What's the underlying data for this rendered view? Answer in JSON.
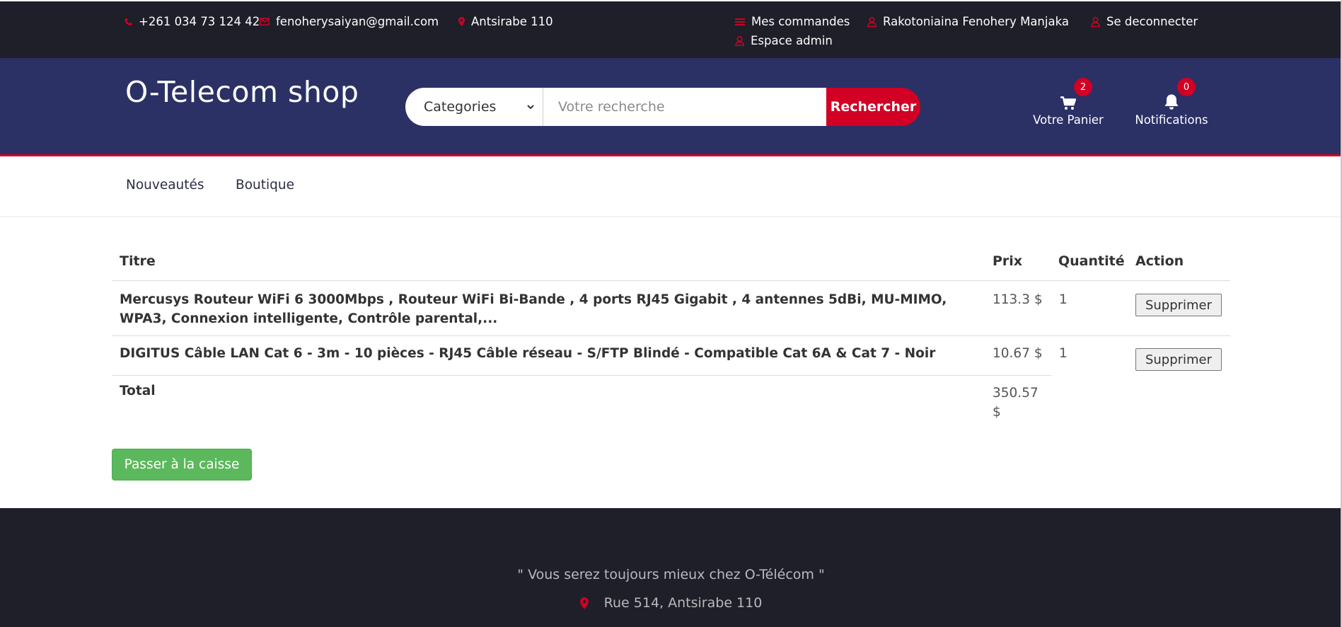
{
  "topbar": {
    "phone": "+261 034 73 124 42",
    "email": "fenoherysaiyan@gmail.com",
    "address": "Antsirabe 110",
    "orders": "Mes commandes",
    "user": "Rakotoniaina Fenohery Manjaka",
    "logout": "Se deconnecter",
    "admin": "Espace admin"
  },
  "header": {
    "logo": "O-Telecom shop",
    "category_select": "Categories",
    "search_placeholder": "Votre recherche",
    "search_button": "Rechercher",
    "cart_label": "Votre Panier",
    "cart_count": "2",
    "notif_label": "Notifications",
    "notif_count": "0"
  },
  "nav": {
    "items": [
      "Nouveautés",
      "Boutique"
    ]
  },
  "cart": {
    "headers": {
      "title": "Titre",
      "price": "Prix",
      "quantity": "Quantité",
      "action": "Action"
    },
    "rows": [
      {
        "title": "Mercusys Routeur WiFi 6 3000Mbps , Routeur WiFi Bi-Bande , 4 ports RJ45 Gigabit , 4 antennes 5dBi, MU-MIMO, WPA3, Connexion intelligente, Contrôle parental,...",
        "price": "113.3 $",
        "quantity": "1",
        "action": "Supprimer"
      },
      {
        "title": "DIGITUS Câble LAN Cat 6 - 3m - 10 pièces - RJ45 Câble réseau - S/FTP Blindé - Compatible Cat 6A & Cat 7 - Noir",
        "price": "10.67 $",
        "quantity": "1",
        "action": "Supprimer"
      }
    ],
    "total_label": "Total",
    "total_value": "350.57 $",
    "checkout": "Passer à la caisse"
  },
  "footer": {
    "quote": "\" Vous serez toujours mieux chez O-Télécom \"",
    "address": "Rue 514, Antsirabe 110"
  },
  "colors": {
    "accent": "#d10024",
    "header_bg": "#2b3065",
    "topbar_bg": "#1e1f29",
    "success": "#5cb85c"
  },
  "icons": [
    "phone-icon",
    "envelope-icon",
    "map-marker-icon",
    "bars-icon",
    "user-icon",
    "cart-icon",
    "bell-icon",
    "chevron-down-icon"
  ]
}
